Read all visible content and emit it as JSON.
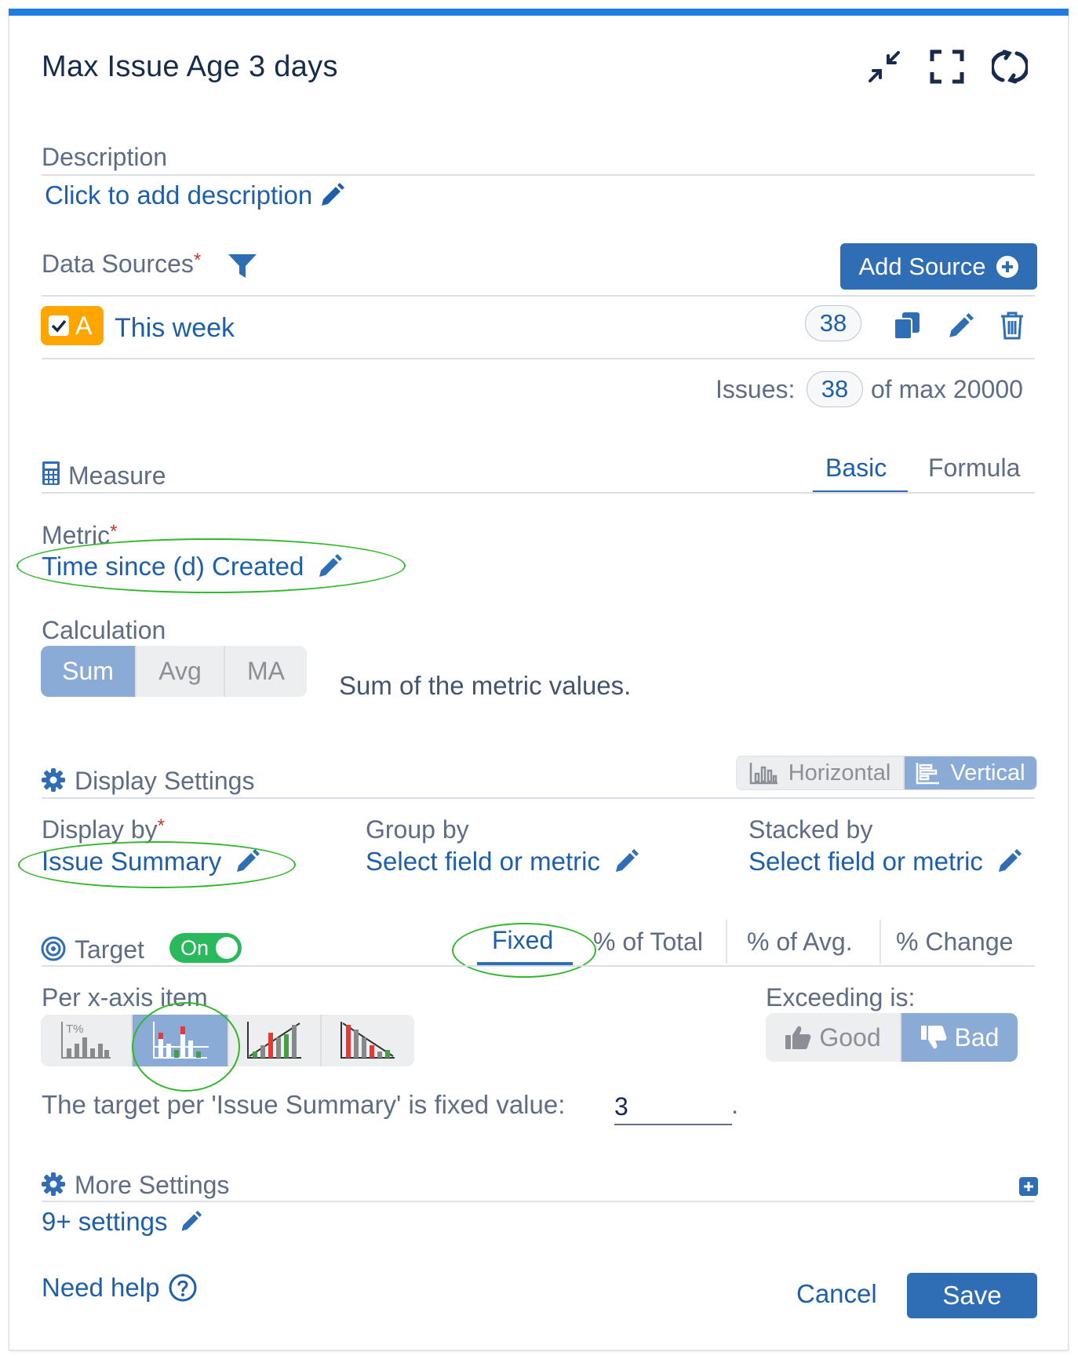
{
  "header": {
    "title": "Max Issue Age 3 days",
    "icons": [
      "minimize-icon",
      "fullscreen-icon",
      "refresh-icon"
    ],
    "accent_color": "#1e7de0"
  },
  "description": {
    "label": "Description",
    "link": "Click to add description"
  },
  "data_sources": {
    "label": "Data Sources",
    "required_mark": "*",
    "add_button": "Add Source",
    "source": {
      "letter": "A",
      "name": "This week",
      "count": "38",
      "badge_color": "#ffa500"
    },
    "issues_label": "Issues:",
    "issues_count": "38",
    "issues_max": "of max 20000"
  },
  "measure": {
    "label": "Measure",
    "tabs": [
      {
        "label": "Basic",
        "active": true
      },
      {
        "label": "Formula",
        "active": false
      }
    ],
    "metric_label": "Metric",
    "metric_required": "*",
    "metric_value": "Time since (d) Created",
    "calculation_label": "Calculation",
    "calculation_options": [
      "Sum",
      "Avg",
      "MA"
    ],
    "calculation_selected": "Sum",
    "calculation_description": "Sum of the metric values."
  },
  "display": {
    "label": "Display Settings",
    "orientation_options": [
      "Horizontal",
      "Vertical"
    ],
    "orientation_selected": "Vertical",
    "display_by_label": "Display by",
    "display_by_required": "*",
    "display_by_value": "Issue Summary",
    "group_by_label": "Group by",
    "group_by_value": "Select field or metric",
    "stacked_by_label": "Stacked by",
    "stacked_by_value": "Select field or metric"
  },
  "target": {
    "label": "Target",
    "toggle_label": "On",
    "toggle_on": true,
    "tabs": [
      {
        "label": "Fixed",
        "active": true
      },
      {
        "label": "% of Total",
        "active": false
      },
      {
        "label": "% of Avg.",
        "active": false
      },
      {
        "label": "% Change",
        "active": false
      }
    ],
    "per_item_label": "Per x-axis item",
    "chart_options": [
      "percent-of-total-chart-icon",
      "fixed-target-chart-icon",
      "rising-target-chart-icon",
      "falling-target-chart-icon"
    ],
    "chart_selected": 1,
    "exceeding_label": "Exceeding is:",
    "exceeding_options": [
      "Good",
      "Bad"
    ],
    "exceeding_selected": "Bad",
    "fixed_text": "The target per 'Issue Summary' is fixed value:",
    "fixed_value": "3",
    "fixed_suffix": "."
  },
  "more_settings": {
    "label": "More Settings",
    "link": "9+ settings"
  },
  "footer": {
    "help": "Need help",
    "cancel": "Cancel",
    "save": "Save"
  }
}
